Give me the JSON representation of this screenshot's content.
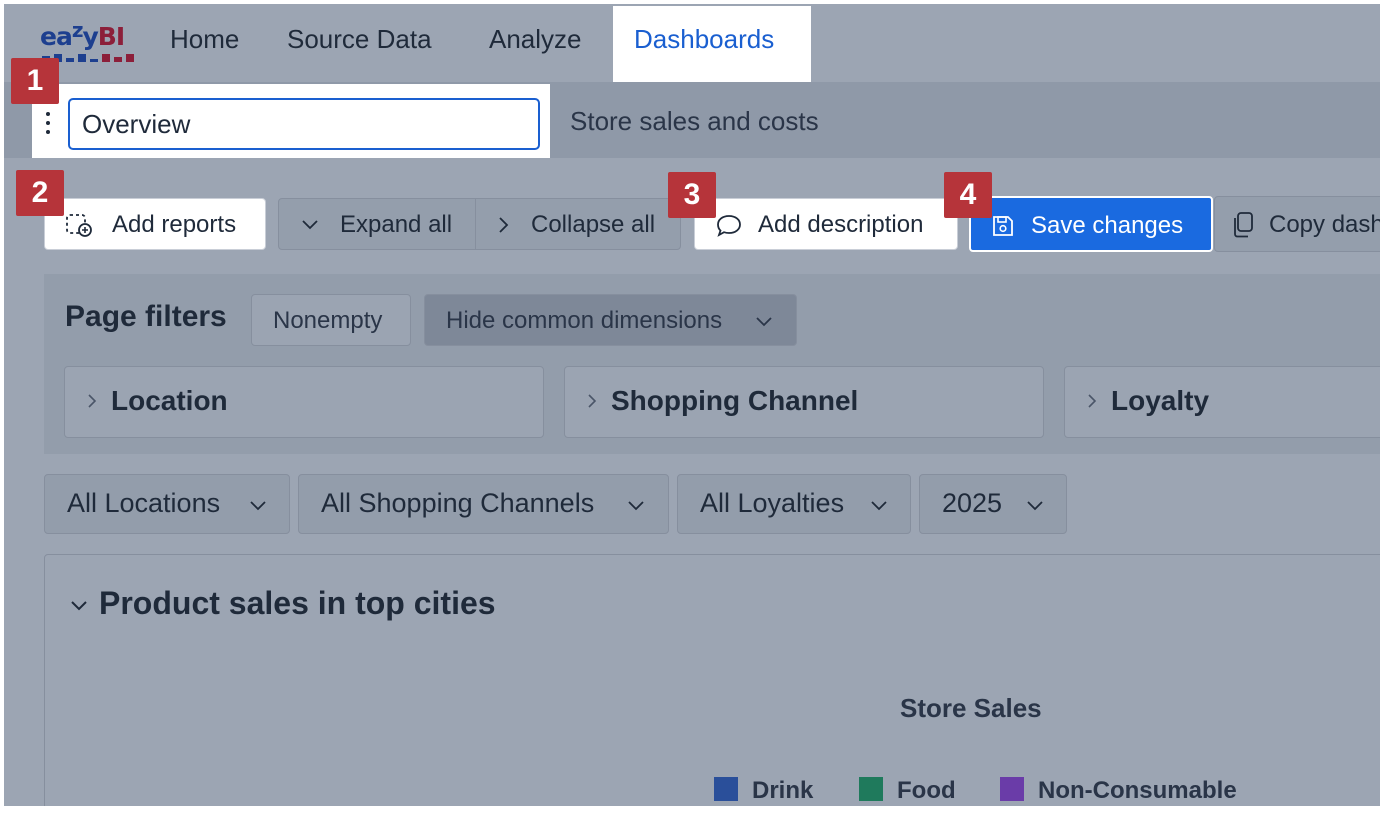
{
  "logo": {
    "text_a": "ea",
    "text_z": "z",
    "text_y": "y",
    "text_b": "BI"
  },
  "nav": {
    "items": [
      {
        "label": "Home"
      },
      {
        "label": "Source Data"
      },
      {
        "label": "Analyze"
      },
      {
        "label": "Dashboards",
        "active": true
      }
    ]
  },
  "dashboard": {
    "name_value": "Overview",
    "description": "Store sales and costs"
  },
  "badges": [
    "1",
    "2",
    "3",
    "4"
  ],
  "toolbar": {
    "add_reports": "Add reports",
    "expand_all": "Expand all",
    "collapse_all": "Collapse all",
    "add_description": "Add description",
    "save_changes": "Save changes",
    "copy_dashboard": "Copy dash"
  },
  "page_filters": {
    "title": "Page filters",
    "nonempty": "Nonempty",
    "hide_common": "Hide common dimensions",
    "dimensions": [
      "Location",
      "Shopping Channel",
      "Loyalty"
    ]
  },
  "filters": [
    {
      "label": "All Locations"
    },
    {
      "label": "All Shopping Channels"
    },
    {
      "label": "All Loyalties"
    },
    {
      "label": "2025"
    }
  ],
  "report": {
    "title": "Product sales in top cities",
    "chart_title": "Store Sales",
    "legend": [
      {
        "label": "Drink",
        "color": "#2a4f9a"
      },
      {
        "label": "Food",
        "color": "#1f7a5c"
      },
      {
        "label": "Non-Consumable",
        "color": "#6a3ca8"
      }
    ]
  },
  "colors": {
    "accent": "#1a5fd0",
    "primary_button": "#1a6ae0",
    "badge": "#b6343a",
    "overlay": "#9ca5b3"
  }
}
